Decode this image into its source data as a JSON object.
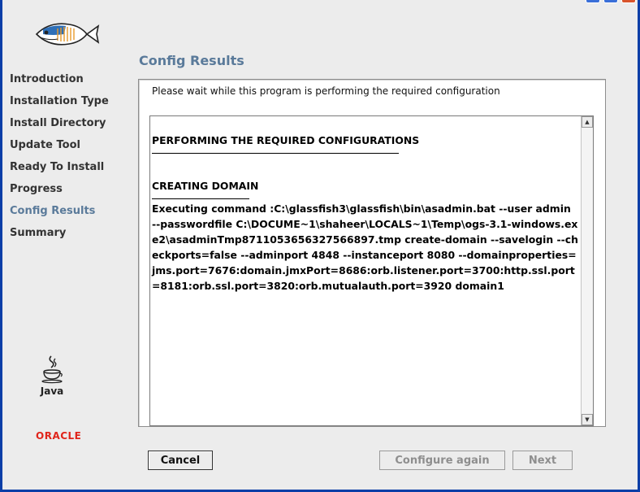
{
  "nav": {
    "items": [
      {
        "label": "Introduction"
      },
      {
        "label": "Installation Type"
      },
      {
        "label": "Install Directory"
      },
      {
        "label": "Update Tool"
      },
      {
        "label": "Ready To Install"
      },
      {
        "label": "Progress"
      },
      {
        "label": "Config Results",
        "active": true
      },
      {
        "label": "Summary"
      }
    ]
  },
  "branding": {
    "java_label": "Java",
    "oracle_label": "ORACLE",
    "fish_icon": "glassfish-icon",
    "accent_color": "#5a7a9a",
    "oracle_color": "#e0251b"
  },
  "main": {
    "title": "Config Results",
    "message": "Please wait while this program is performing the required configuration",
    "log": {
      "heading1": "PERFORMING THE REQUIRED CONFIGURATIONS",
      "heading2": "CREATING DOMAIN",
      "command": "Executing command :C:\\glassfish3\\glassfish\\bin\\asadmin.bat --user admin --passwordfile C:\\DOCUME~1\\shaheer\\LOCALS~1\\Temp\\ogs-3.1-windows.exe2\\asadminTmp8711053656327566897.tmp create-domain --savelogin --checkports=false --adminport 4848 --instanceport 8080 --domainproperties=jms.port=7676:domain.jmxPort=8686:orb.listener.port=3700:http.ssl.port=8181:orb.ssl.port=3820:orb.mutualauth.port=3920 domain1"
    }
  },
  "footer": {
    "cancel_label": "Cancel",
    "configure_again_label": "Configure again",
    "next_label": "Next"
  }
}
